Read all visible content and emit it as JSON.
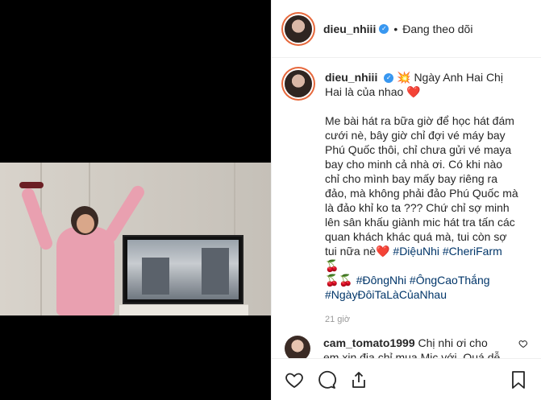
{
  "post": {
    "username": "dieu_nhiii",
    "follow_status": "Đang theo dõi",
    "caption_line1": "💥 Ngày Anh Hai Chị Hai là của nhao ❤️",
    "caption_para": "Me bài hát ra bữa giờ để học hát đám cưới nè, bây giờ chỉ đợi vé máy bay Phú Quốc thôi, chỉ chưa gửi vé maya bay cho minh cả nhà ơi. Có khi nào chỉ cho mình bay mấy bay riêng ra đảo, mà không phải đảo Phú Quốc mà là đảo khỉ ko ta ??? Chứ chỉ sợ minh lên sân khấu giành mic hát tra tấn các quan khách khác quá mà, tui còn sợ tui nữa nè❤️ ",
    "hashtags_line1": "#DiệuNhi #CheriFarm 🍒",
    "hashtags_line2": "🍒🍒 #ĐôngNhi #ÔngCaoThắng",
    "hashtags_line3": "#NgàyĐôiTaLàCủaNhau",
    "time_ago": "21 giờ"
  },
  "comment": {
    "username": "cam_tomato1999",
    "text": "Chị nhi ơi cho em xin địa chỉ mua Mic với. Quá dễ thương"
  },
  "icons": {
    "verified": "verified-badge-icon",
    "actions": [
      "heart-icon",
      "comment-icon",
      "share-icon",
      "bookmark-icon"
    ]
  },
  "colors": {
    "text": "#262626",
    "verified": "#3897f0",
    "hashtag": "#003569",
    "muted": "#999999"
  }
}
